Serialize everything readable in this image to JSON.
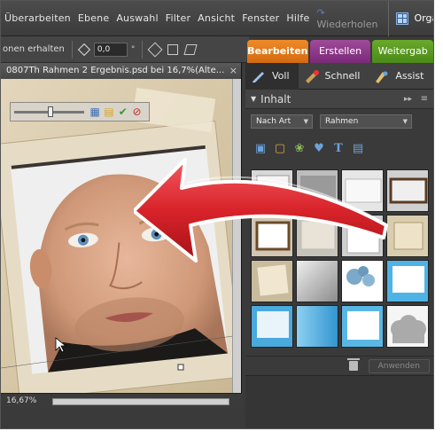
{
  "menubar": {
    "items": [
      "Überarbeiten",
      "Ebene",
      "Auswahl",
      "Filter",
      "Ansicht",
      "Fenster",
      "Hilfe"
    ],
    "undo_label": "Wiederholen",
    "organizer_label": "Organizer"
  },
  "optionsbar": {
    "label": "onen erhalten",
    "angle_value": "0,0"
  },
  "mode_tabs": {
    "edit": "Bearbeiten",
    "create": "Erstellen",
    "share": "Weitergab"
  },
  "document": {
    "title": "0807Th Rahmen 2 Ergebnis.psd bei 16,7%(Alte...",
    "close": "×",
    "zoom": "16,67%"
  },
  "panel": {
    "tabs": [
      "Voll",
      "Schnell",
      "Assist"
    ],
    "section_title": "Inhalt",
    "sort_dropdown": "Nach Art",
    "type_dropdown": "Rahmen",
    "apply_label": "Anwenden"
  },
  "colors": {
    "edit_tab": "#e27a1a",
    "create_tab": "#8c3a8a",
    "share_tab": "#5a9a22",
    "arrow_red": "#d8232a"
  }
}
